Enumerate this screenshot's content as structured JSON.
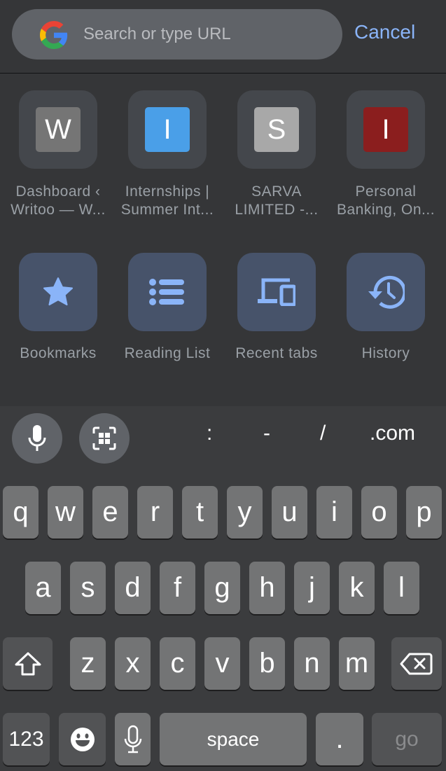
{
  "omnibox": {
    "placeholder": "Search or type URL",
    "value": "",
    "logo_icon": "google-g-icon",
    "cancel_label": "Cancel"
  },
  "most_visited": [
    {
      "letter": "W",
      "title_line1": "Dashboard ‹",
      "title_line2": "Writoo — W...",
      "color": "#757575"
    },
    {
      "letter": "I",
      "title_line1": "Internships |",
      "title_line2": "Summer Int...",
      "color": "#4a9fe8"
    },
    {
      "letter": "S",
      "title_line1": "SARVA",
      "title_line2": "LIMITED -...",
      "color": "#a8a8a8"
    },
    {
      "letter": "I",
      "title_line1": "Personal",
      "title_line2": "Banking, On...",
      "color": "#8b1e1e"
    }
  ],
  "shortcuts": [
    {
      "label": "Bookmarks",
      "icon": "star-icon"
    },
    {
      "label": "Reading List",
      "icon": "list-icon"
    },
    {
      "label": "Recent tabs",
      "icon": "devices-icon"
    },
    {
      "label": "History",
      "icon": "history-icon"
    }
  ],
  "accent_color": "#8ab4f8",
  "keyboard": {
    "accessory": {
      "voice_icon": "microphone-icon",
      "qr_icon": "qr-scan-icon",
      "keys": [
        ":",
        "-",
        "/",
        ".com"
      ]
    },
    "row1": [
      "q",
      "w",
      "e",
      "r",
      "t",
      "y",
      "u",
      "i",
      "o",
      "p"
    ],
    "row2": [
      "a",
      "s",
      "d",
      "f",
      "g",
      "h",
      "j",
      "k",
      "l"
    ],
    "row3": [
      "z",
      "x",
      "c",
      "v",
      "b",
      "n",
      "m"
    ],
    "shift_icon": "shift-icon",
    "delete_icon": "backspace-icon",
    "numbers_label": "123",
    "emoji_icon": "emoji-icon",
    "dictation_icon": "microphone-icon",
    "space_label": "space",
    "period_label": ".",
    "go_label": "go"
  }
}
